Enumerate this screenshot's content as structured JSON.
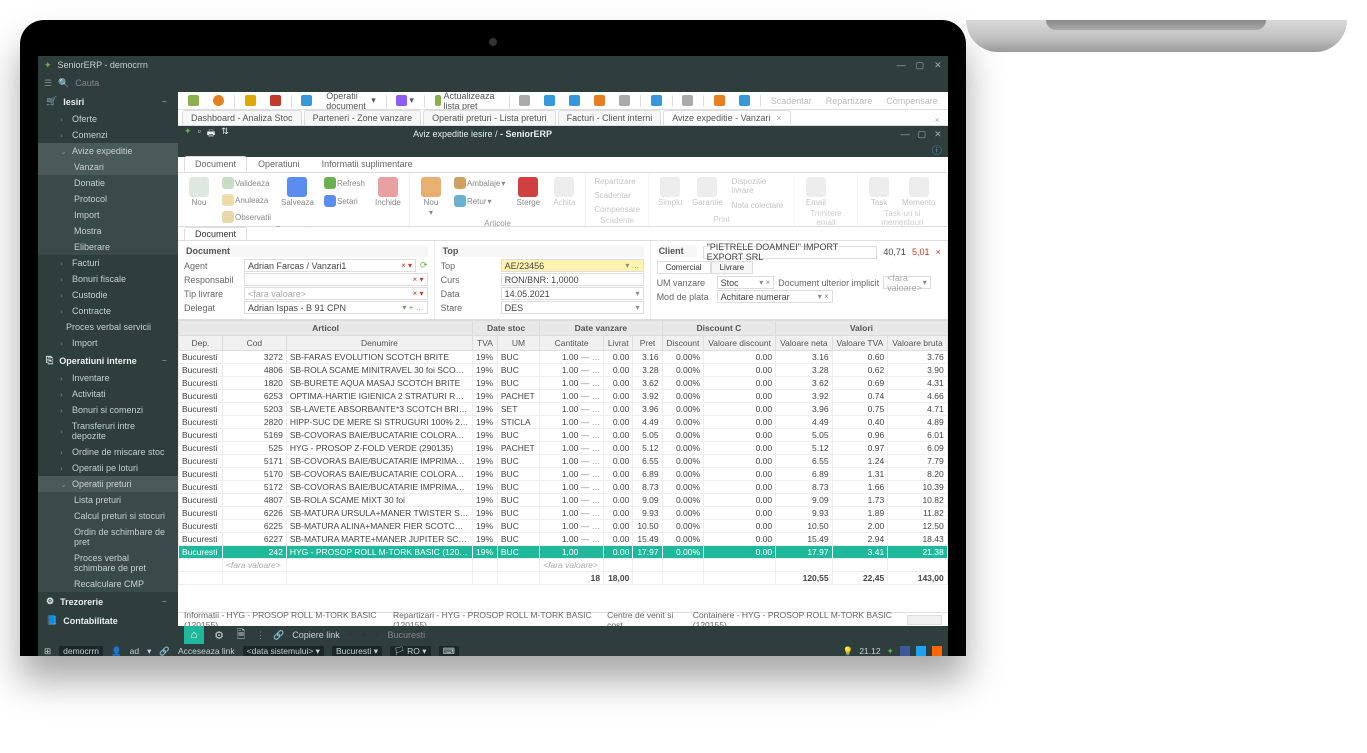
{
  "app": {
    "title": "SeniorERP - democrrn",
    "search_placeholder": "Cauta"
  },
  "sidebar": {
    "cat1": "Iesiri",
    "items": [
      "Oferte",
      "Comenzi",
      "Avize expeditie"
    ],
    "sub_avize": [
      "Vanzari",
      "Donatie",
      "Protocol",
      "Import",
      "Mostra",
      "Eliberare"
    ],
    "items2": [
      "Facturi",
      "Bonuri fiscale",
      "Custodie",
      "Contracte",
      "Proces verbal servicii",
      "Import"
    ],
    "cat2": "Operatiuni interne",
    "items3": [
      "Inventare",
      "Activitati",
      "Bonuri si comenzi",
      "Transferuri intre depozite",
      "Ordine de miscare stoc",
      "Operatii pe loturi",
      "Operatii preturi"
    ],
    "sub_preturi": [
      "Lista preturi",
      "Calcul preturi si stocuri",
      "Ordin de schimbare de pret",
      "Proces verbal schimbare de  pret",
      "Recalculare CMP"
    ],
    "cat3": "Trezorerie",
    "cat4": "Contabilitate"
  },
  "toolbar": {
    "ops": "Operatii document",
    "act": "Actualizeaza lista pret",
    "scad": "Scadentar",
    "repart": "Repartizare",
    "comp": "Compensare"
  },
  "tabs": [
    "Dashboard - Analiza Stoc",
    "Parteneri - Zone vanzare",
    "Operatii preturi - Lista preturi",
    "Facturi - Client interni",
    "Avize expeditie - Vanzari"
  ],
  "inner": {
    "title_left": "Aviz expeditie iesire /",
    "title_app": " - SeniorERP",
    "ribtabs": [
      "Document",
      "Operatiuni",
      "Informatii suplimentare"
    ],
    "groups": {
      "doc": "Document",
      "nou": "Nou",
      "salv": "Salveaza",
      "refresh": "Refresh",
      "inchide": "Inchide",
      "nou2": "Nou",
      "retur": "Retur",
      "sterge": "Sterge",
      "achita": "Achita",
      "valid": "Valideaza",
      "anul": "Anuleaza",
      "obs": "Observatii",
      "setari": "Setari",
      "ambal": "Ambalaje",
      "art": "Articole",
      "scad": "Scadente",
      "print": "Print",
      "email": "Trimitere email",
      "task": "Task-uri si mementouri",
      "repart": "Repartizare",
      "scad2": "Scadentar",
      "comp": "Compensare",
      "simplu": "Simplu",
      "garantie": "Garantie",
      "dispoz": "Dispozitie livrare",
      "nota": "Nota colectare",
      "emailbtn": "Email",
      "taskbtn": "Task",
      "memento": "Memento"
    }
  },
  "form": {
    "h_doc": "Document",
    "h_top": "Top",
    "h_client": "Client",
    "agent_l": "Agent",
    "agent": "Adrian Farcas / Vanzari1",
    "resp_l": "Responsabil",
    "resp": "",
    "tipliv_l": "Tip livrare",
    "tipliv": "<fara valoare>",
    "delegat_l": "Delegat",
    "delegat": "Adrian  Ispas - B 91 CPN",
    "top_l": "Top",
    "top": "AE/23456",
    "curs_l": "Curs",
    "curs": "RON/BNR: 1,0000",
    "data_l": "Data",
    "data": "14.05.2021",
    "stare_l": "Stare",
    "stare": "DES",
    "client": "\"PIETRELE DOAMNEI\" IMPORT EXPORT SRL",
    "tab_com": "Comercial",
    "tab_liv": "Livrare",
    "um_l": "UM vanzare",
    "um": "Stoc",
    "mod_l": "Mod de plata",
    "mod": "Achitare numerar",
    "docul_l": "Document ulterior implicit",
    "docul": "<fara valoare>",
    "v1": "40,71",
    "v2": "5,01"
  },
  "grid": {
    "g_art": "Articol",
    "g_stoc": "Date stoc",
    "g_vanz": "Date vanzare",
    "g_disc": "Discount C",
    "g_val": "Valori",
    "h": [
      "Dep.",
      "Cod",
      "Denumire",
      "TVA",
      "UM",
      "Cantitate",
      "Livrat",
      "Pret",
      "Discount",
      "Valoare discount",
      "Valoare neta",
      "Valoare TVA",
      "Valoare bruta"
    ],
    "rows": [
      [
        "Bucuresti",
        "3272",
        "SB-FARAS EVOLUTION SCOTCH BRITE",
        "19%",
        "BUC",
        "1.00",
        "0.00",
        "3.16",
        "0.00%",
        "0.00",
        "3.16",
        "0.60",
        "3.76"
      ],
      [
        "Bucuresti",
        "4806",
        "SB-ROLA SCAME MINITRAVEL 30 foi SCOTC…",
        "19%",
        "BUC",
        "1.00",
        "0.00",
        "3.28",
        "0.00%",
        "0.00",
        "3.28",
        "0.62",
        "3.90"
      ],
      [
        "Bucuresti",
        "1820",
        "SB-BURETE AQUA MASAJ SCOTCH BRITE",
        "19%",
        "BUC",
        "1.00",
        "0.00",
        "3.62",
        "0.00%",
        "0.00",
        "3.62",
        "0.69",
        "4.31"
      ],
      [
        "Bucuresti",
        "6253",
        "OPTIMA-HARTIE IGIENICA 2 STRATURI ROZ …",
        "19%",
        "PACHET",
        "1.00",
        "0.00",
        "3.92",
        "0.00%",
        "0.00",
        "3.92",
        "0.74",
        "4.66"
      ],
      [
        "Bucuresti",
        "5203",
        "SB-LAVETE ABSORBANTE*3 SCOTCH BRITE",
        "19%",
        "SET",
        "1.00",
        "0.00",
        "3.96",
        "0.00%",
        "0.00",
        "3.96",
        "0.75",
        "4.71"
      ],
      [
        "Bucuresti",
        "2820",
        "HIPP-SUC DE MERE SI STRUGURI 100% 200…",
        "19%",
        "STICLA",
        "1.00",
        "0.00",
        "4.49",
        "0.00%",
        "0.00",
        "4.49",
        "0.40",
        "4.89"
      ],
      [
        "Bucuresti",
        "5169",
        "SB-COVORAS BAIE/BUCATARIE COLORAT 40…",
        "19%",
        "BUC",
        "1.00",
        "0.00",
        "5.05",
        "0.00%",
        "0.00",
        "5.05",
        "0.96",
        "6.01"
      ],
      [
        "Bucuresti",
        "525",
        "HYG - PROSOP Z-FOLD VERDE (290135)",
        "19%",
        "PACHET",
        "1.00",
        "0.00",
        "5.12",
        "0.00%",
        "0.00",
        "5.12",
        "0.97",
        "6.09"
      ],
      [
        "Bucuresti",
        "5171",
        "SB-COVORAS BAIE/BUCATARIE IMPRIMAT 4…",
        "19%",
        "BUC",
        "1.00",
        "0.00",
        "6.55",
        "0.00%",
        "0.00",
        "6.55",
        "1.24",
        "7.79"
      ],
      [
        "Bucuresti",
        "5170",
        "SB-COVORAS BAIE/BUCATARIE COLORAT 50…",
        "19%",
        "BUC",
        "1.00",
        "0.00",
        "6.89",
        "0.00%",
        "0.00",
        "6.89",
        "1.31",
        "8.20"
      ],
      [
        "Bucuresti",
        "5172",
        "SB-COVORAS BAIE/BUCATARIE IMPRIMAT 5…",
        "19%",
        "BUC",
        "1.00",
        "0.00",
        "8.73",
        "0.00%",
        "0.00",
        "8.73",
        "1.66",
        "10.39"
      ],
      [
        "Bucuresti",
        "4807",
        "SB-ROLA SCAME MIXT 30 foi",
        "19%",
        "BUC",
        "1.00",
        "0.00",
        "9.09",
        "0.00%",
        "0.00",
        "9.09",
        "1.73",
        "10.82"
      ],
      [
        "Bucuresti",
        "6226",
        "SB-MATURA URSULA+MANER TWISTER SC…",
        "19%",
        "BUC",
        "1.00",
        "0.00",
        "9.93",
        "0.00%",
        "0.00",
        "9.93",
        "1.89",
        "11.82"
      ],
      [
        "Bucuresti",
        "6225",
        "SB-MATURA ALINA+MANER FIER SCOTCH B…",
        "19%",
        "BUC",
        "1.00",
        "0.00",
        "10.50",
        "0.00%",
        "0.00",
        "10.50",
        "2.00",
        "12.50"
      ],
      [
        "Bucuresti",
        "6227",
        "SB-MATURA MARTE+MANER JUPITER SCOT…",
        "19%",
        "BUC",
        "1.00",
        "0.00",
        "15.49",
        "0.00%",
        "0.00",
        "15.49",
        "2.94",
        "18.43"
      ],
      [
        "Bucuresti",
        "242",
        "HYG - PROSOP ROLL M-TORK BASIC (120155)",
        "19%",
        "BUC",
        "1,00",
        "0.00",
        "17.97",
        "0.00%",
        "0.00",
        "17.97",
        "3.41",
        "21.38"
      ]
    ],
    "empty": "<fara valoare>",
    "totals": {
      "qty": "18",
      "livrat": "18,00",
      "neta": "120,55",
      "tva": "22,45",
      "bruta": "143,00"
    }
  },
  "footer": {
    "t1": "Informatii - HYG - PROSOP ROLL M-TORK BASIC (120155)",
    "t2": "Repartizari - HYG - PROSOP ROLL M-TORK BASIC (120155)",
    "t3": "Centre de venit si cost",
    "t4": "Containere - HYG - PROSOP ROLL M-TORK BASIC (120155)",
    "copiere": "Copiere link"
  },
  "status": {
    "user": "democrrn",
    "ad": "ad",
    "acces": "Acceseaza link",
    "data": "<data sistemului>",
    "loc": "Bucuresti",
    "lang": "RO",
    "time": "21.12"
  }
}
